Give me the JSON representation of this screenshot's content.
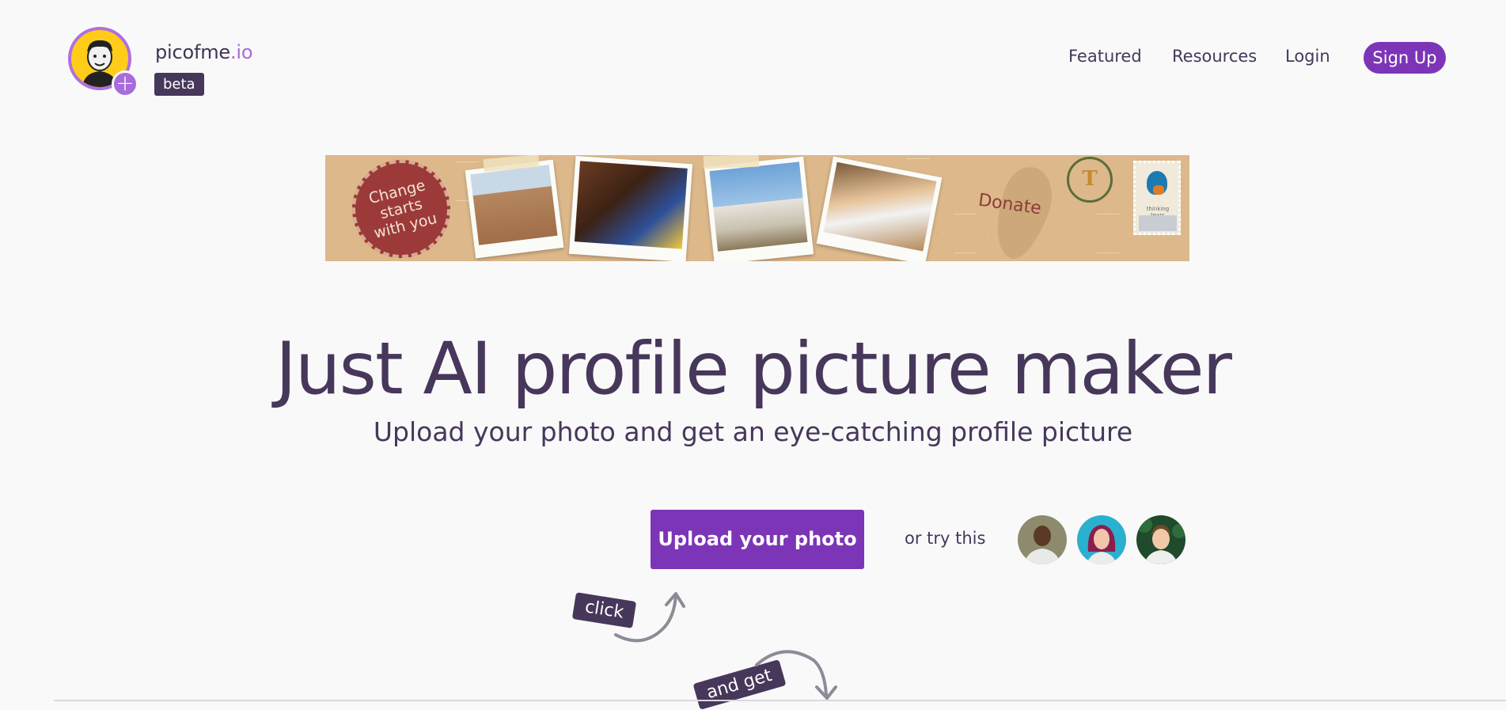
{
  "header": {
    "brand_name": "picofme",
    "brand_tld": ".io",
    "badge": "beta",
    "nav": [
      {
        "label": "Featured"
      },
      {
        "label": "Resources"
      },
      {
        "label": "Login"
      }
    ],
    "signup_label": "Sign Up",
    "accent_color": "#7d35b8"
  },
  "banner": {
    "stamp_text": "Change starts with you",
    "donate_text": "Donate",
    "seal_letter": "T",
    "postage_caption": "thinking tears"
  },
  "hero": {
    "title": "Just AI profile picture maker",
    "subtitle": "Upload your photo and get an eye-catching profile picture",
    "upload_label": "Upload your photo",
    "or_try_label": "or try this",
    "samples": [
      "sample-photo-man",
      "sample-photo-woman",
      "sample-photo-young-man"
    ],
    "click_tag": "click",
    "and_get_tag": "and get"
  }
}
